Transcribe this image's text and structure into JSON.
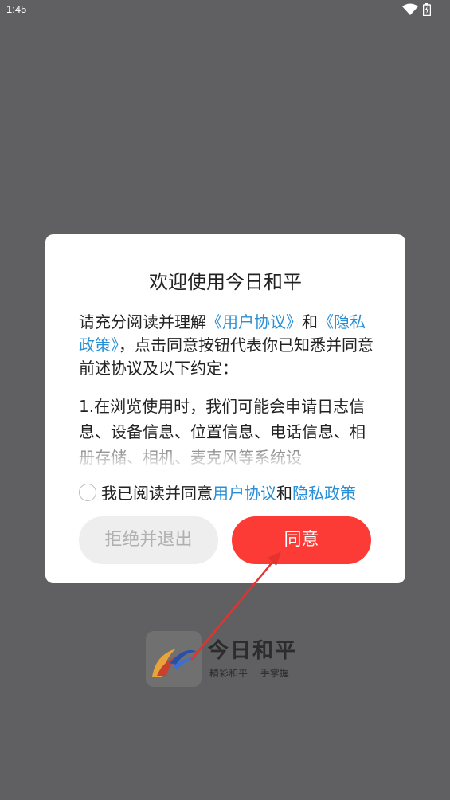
{
  "status_bar": {
    "time": "1:45",
    "wifi_icon": "wifi-icon",
    "battery_icon": "battery-icon"
  },
  "dialog": {
    "title": "欢迎使用今日和平",
    "intro_prefix": "请充分阅读并理解",
    "user_agreement_link": "《用户协议》",
    "intro_and": "和",
    "privacy_policy_link": "《隐私政策》",
    "intro_suffix": "，点击同意按钮代表你已知悉并同意前述协议及以下约定：",
    "terms_text": "1.在浏览使用时，我们可能会申请日志信息、设备信息、位置信息、电话信息、相册存储、相机、麦克风等系统设",
    "agree_prefix": "我已阅读并同意",
    "agree_user_agreement": "用户协议",
    "agree_and": "和",
    "agree_privacy_policy": "隐私政策",
    "reject_button": "拒绝并退出",
    "agree_button": "同意"
  },
  "splash": {
    "app_name": "今日和平",
    "slogan": "精彩和平 一手掌握",
    "logo_icon": "app-logo-icon"
  },
  "colors": {
    "accent_red": "#fc3a36",
    "link_blue": "#2a8fd6",
    "overlay_gray": "#606062",
    "annotation_arrow": "#e5322d"
  }
}
